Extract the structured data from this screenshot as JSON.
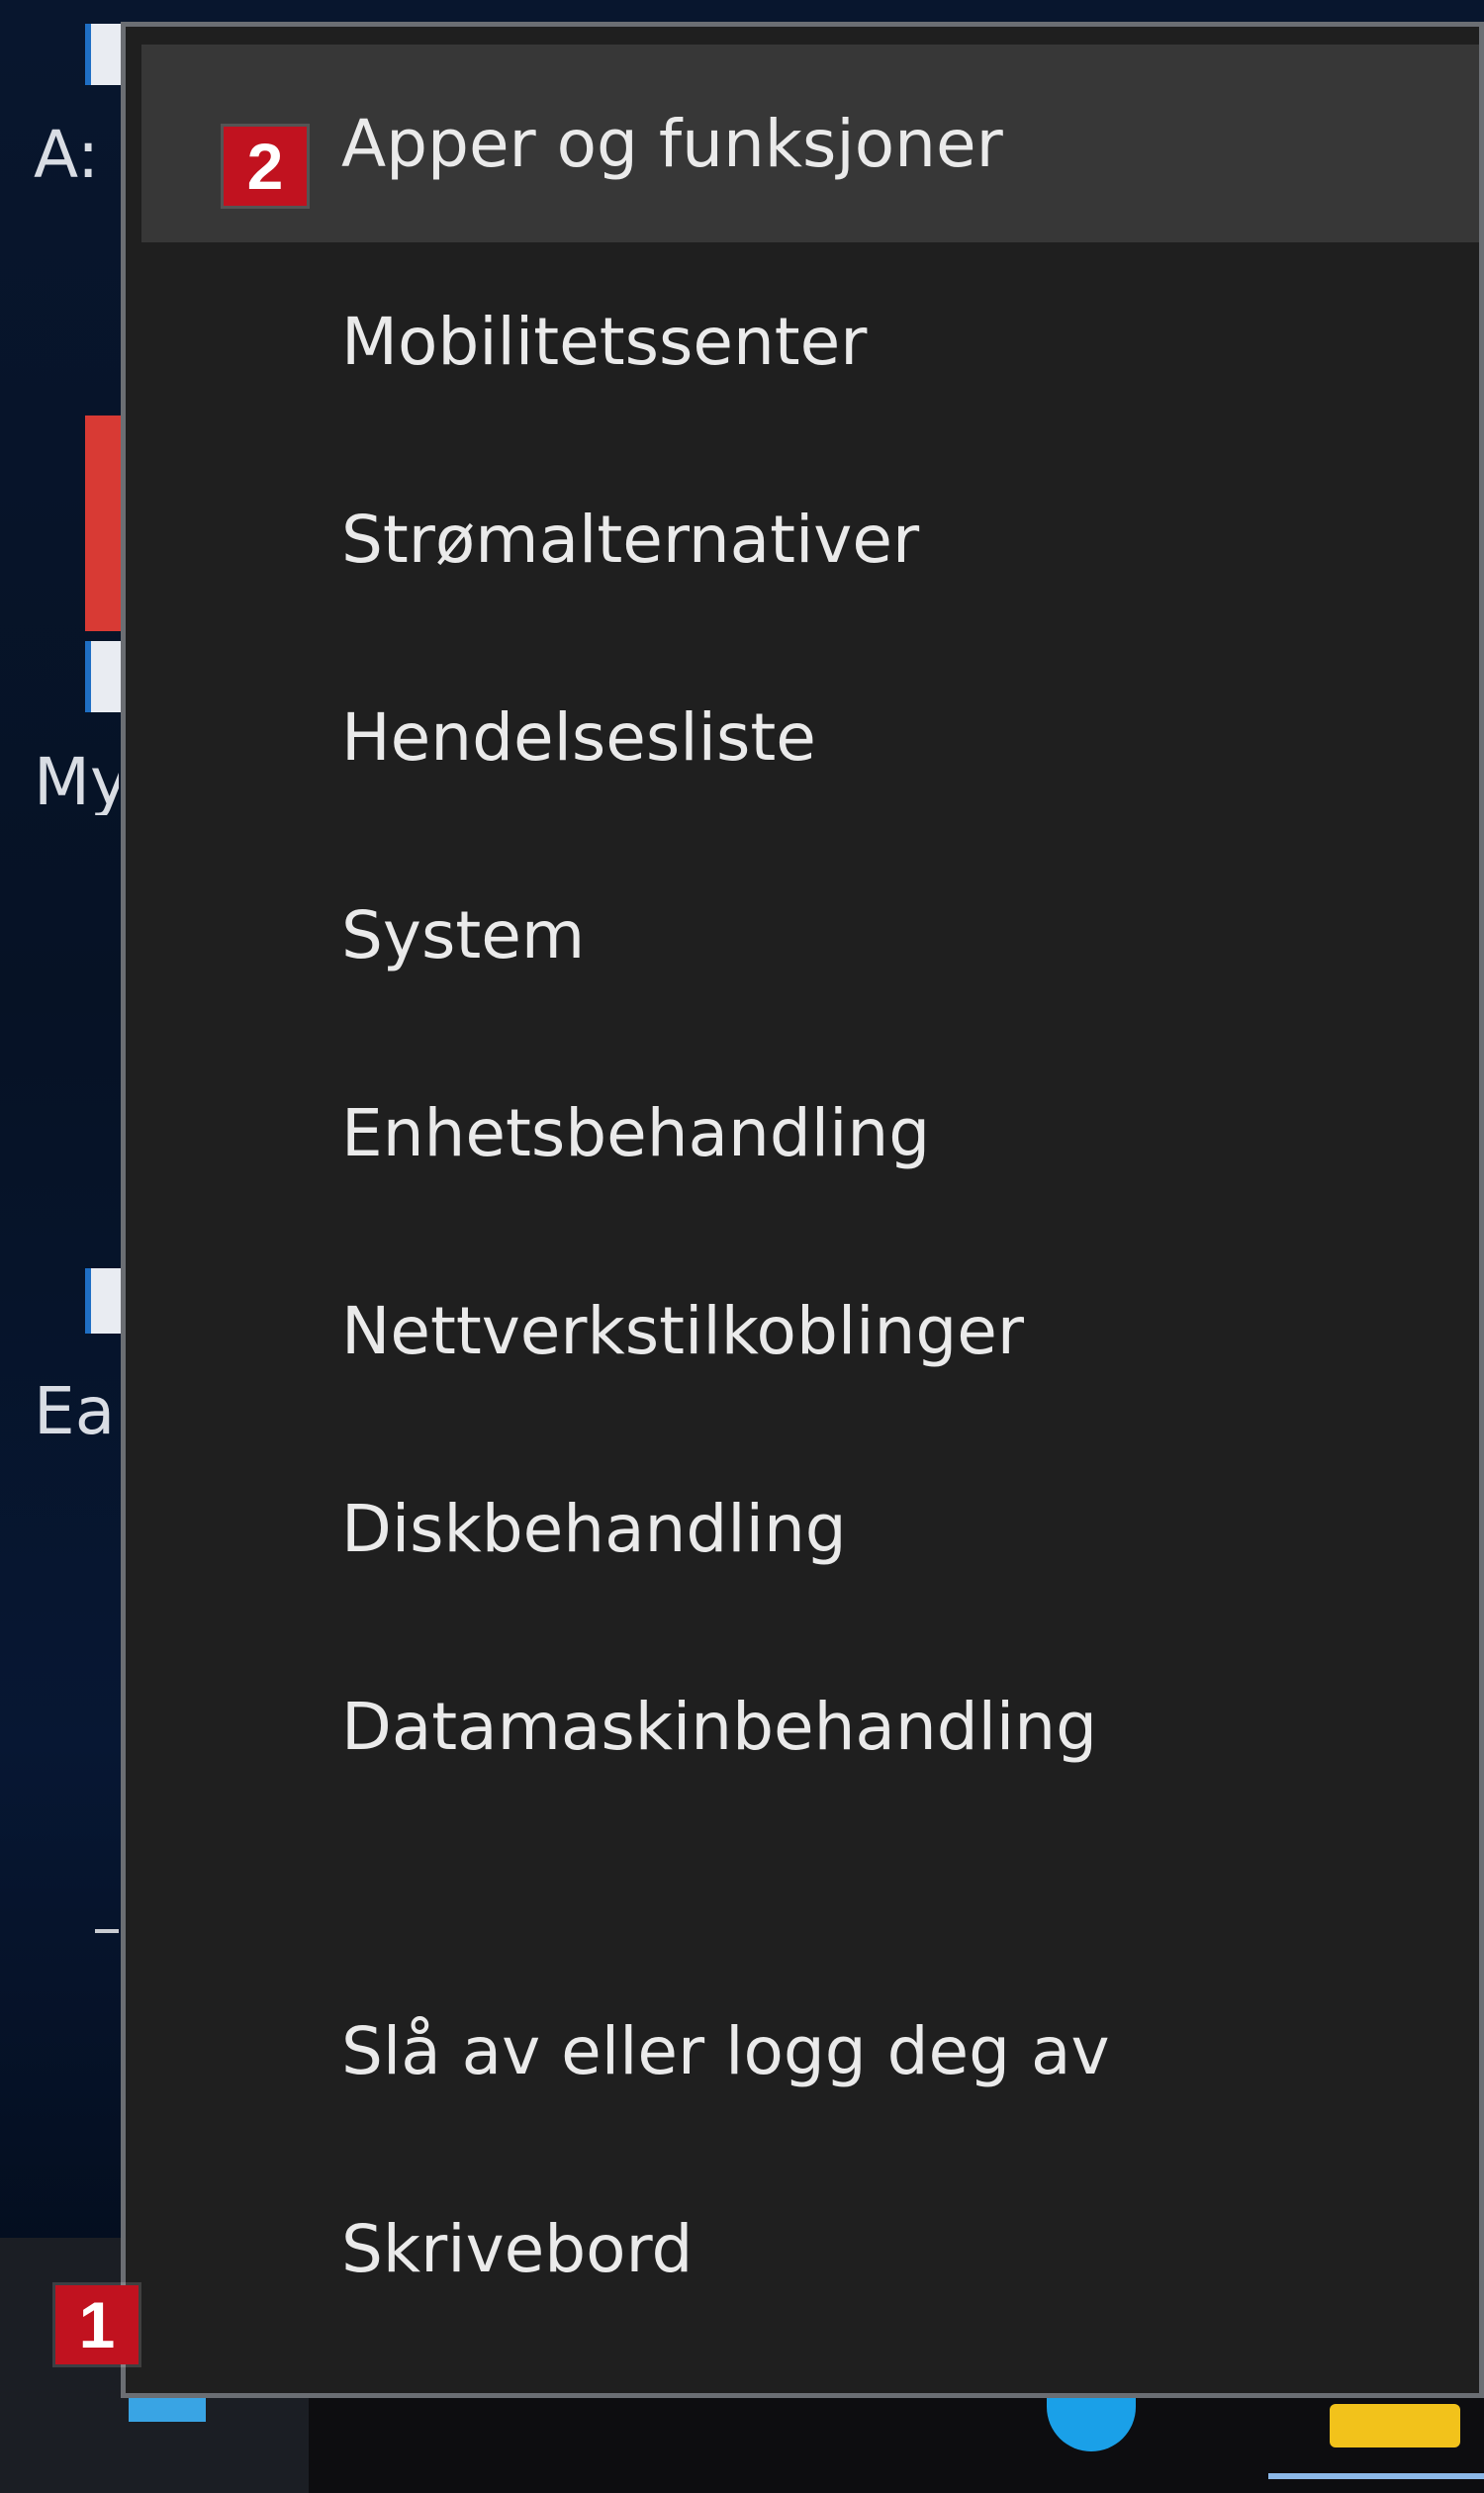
{
  "desktop": {
    "icon_labels": [
      "A:",
      "My",
      "Ea"
    ]
  },
  "menu": {
    "items": [
      {
        "label": "Apper og funksjoner",
        "highlighted": true
      },
      {
        "label": "Mobilitetssenter",
        "highlighted": false
      },
      {
        "label": "Strømalternativer",
        "highlighted": false
      },
      {
        "label": "Hendelsesliste",
        "highlighted": false
      },
      {
        "label": "System",
        "highlighted": false
      },
      {
        "label": "Enhetsbehandling",
        "highlighted": false
      },
      {
        "label": "Nettverkstilkoblinger",
        "highlighted": false
      },
      {
        "label": "Diskbehandling",
        "highlighted": false
      },
      {
        "label": "Datamaskinbehandling",
        "highlighted": false
      },
      {
        "label": "Slå av eller logg deg av",
        "highlighted": false
      },
      {
        "label": "Skrivebord",
        "highlighted": false
      }
    ]
  },
  "badges": {
    "step_1": "1",
    "step_2": "2"
  },
  "colors": {
    "menu_background": "#1f1f1f",
    "menu_highlight": "#373737",
    "menu_text": "#eaeaea",
    "badge_red": "#c1121f"
  }
}
